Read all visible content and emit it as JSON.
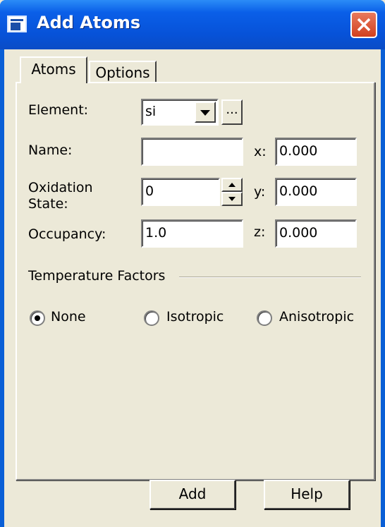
{
  "window": {
    "title": "Add Atoms"
  },
  "tabs": [
    {
      "label": "Atoms",
      "active": true
    },
    {
      "label": "Options",
      "active": false
    }
  ],
  "form": {
    "element_label": "Element:",
    "element_value": "si",
    "browse_label": "...",
    "name_label": "Name:",
    "name_value": "",
    "oxidation_label_1": "Oxidation",
    "oxidation_label_2": "State:",
    "oxidation_value": "0",
    "occupancy_label": "Occupancy:",
    "occupancy_value": "1.0",
    "x_label": "x:",
    "x_value": "0.000",
    "y_label": "y:",
    "y_value": "0.000",
    "z_label": "z:",
    "z_value": "0.000"
  },
  "temperature_factors": {
    "title": "Temperature Factors",
    "options": [
      {
        "label": "None",
        "selected": true
      },
      {
        "label": "Isotropic",
        "selected": false
      },
      {
        "label": "Anisotropic",
        "selected": false
      }
    ]
  },
  "buttons": {
    "add": "Add",
    "help": "Help"
  },
  "icons": {
    "app": "window-icon",
    "close": "close-icon",
    "dropdown": "chevron-down-icon",
    "spin_up": "arrow-up-icon",
    "spin_down": "arrow-down-icon"
  },
  "colors": {
    "titlebar": "#0a5fe8",
    "close": "#d2401e",
    "face": "#ece9d8"
  }
}
